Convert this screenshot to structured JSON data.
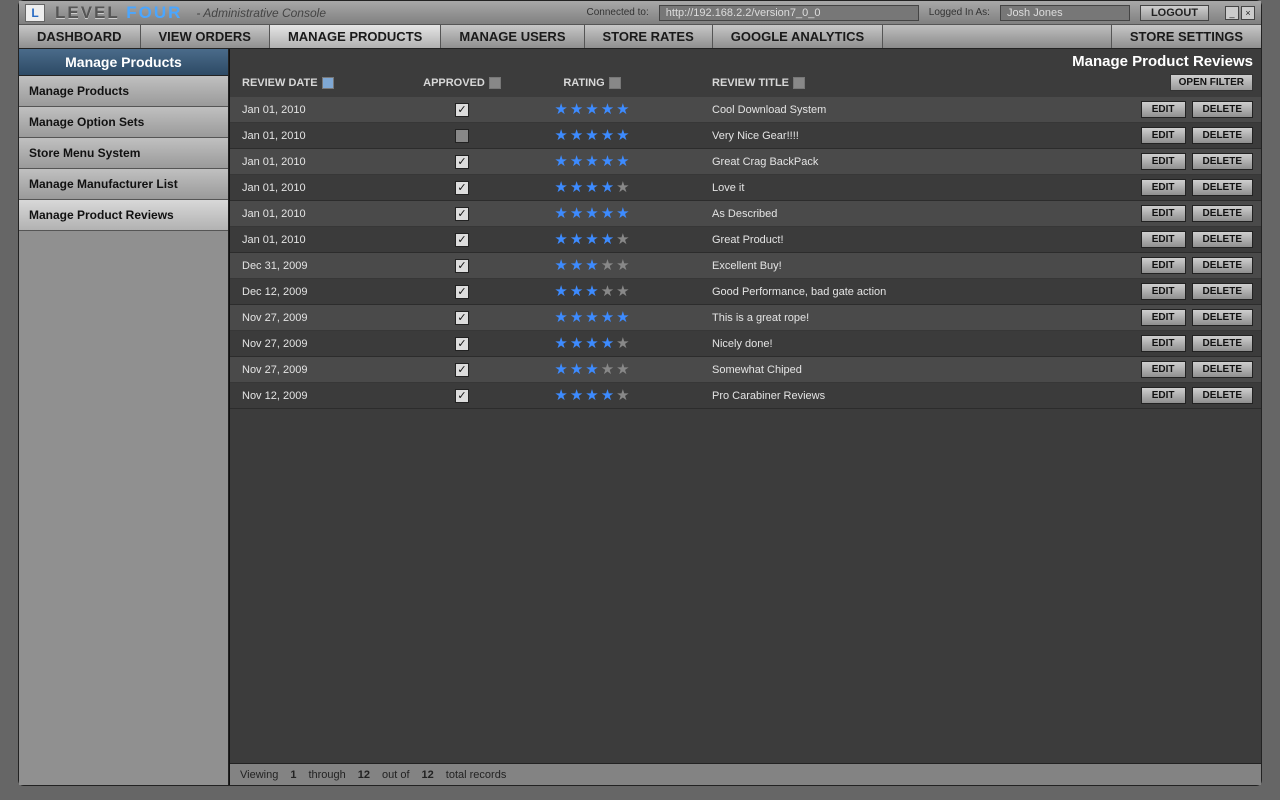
{
  "titlebar": {
    "logo_letter": "L",
    "brand_a": "LEVEL",
    "brand_b": "FOUR",
    "subtitle": "- Administrative Console",
    "connected_label": "Connected to:",
    "connected_url": "http://192.168.2.2/version7_0_0",
    "logged_in_label": "Logged In As:",
    "logged_in_user": "Josh Jones",
    "logout": "LOGOUT"
  },
  "tabs": {
    "dashboard": "DASHBOARD",
    "view_orders": "VIEW ORDERS",
    "manage_products": "MANAGE PRODUCTS",
    "manage_users": "MANAGE USERS",
    "store_rates": "STORE RATES",
    "google_analytics": "GOOGLE ANALYTICS",
    "store_settings": "STORE SETTINGS"
  },
  "sidebar": {
    "title": "Manage Products",
    "items": {
      "products": "Manage Products",
      "option_sets": "Manage Option Sets",
      "menu_system": "Store Menu System",
      "mfr_list": "Manage Manufacturer List",
      "reviews": "Manage Product Reviews"
    }
  },
  "page": {
    "title": "Manage Product Reviews",
    "open_filter": "OPEN FILTER",
    "columns": {
      "date": "REVIEW DATE",
      "approved": "APPROVED",
      "rating": "RATING",
      "title": "REVIEW TITLE"
    }
  },
  "buttons": {
    "edit": "EDIT",
    "delete": "DELETE"
  },
  "rows": [
    {
      "date": "Jan  01, 2010",
      "approved": true,
      "rating": 5,
      "title": "Cool Download System"
    },
    {
      "date": "Jan  01, 2010",
      "approved": false,
      "rating": 5,
      "title": "Very Nice Gear!!!!"
    },
    {
      "date": "Jan  01, 2010",
      "approved": true,
      "rating": 5,
      "title": "Great Crag BackPack"
    },
    {
      "date": "Jan  01, 2010",
      "approved": true,
      "rating": 4,
      "title": "Love it"
    },
    {
      "date": "Jan  01, 2010",
      "approved": true,
      "rating": 5,
      "title": "As Described"
    },
    {
      "date": "Jan  01, 2010",
      "approved": true,
      "rating": 4,
      "title": "Great Product!"
    },
    {
      "date": "Dec  31, 2009",
      "approved": true,
      "rating": 3,
      "title": "Excellent Buy!"
    },
    {
      "date": "Dec  12, 2009",
      "approved": true,
      "rating": 3,
      "title": "Good Performance, bad gate action"
    },
    {
      "date": "Nov  27, 2009",
      "approved": true,
      "rating": 5,
      "title": "This is a great rope!"
    },
    {
      "date": "Nov  27, 2009",
      "approved": true,
      "rating": 4,
      "title": "Nicely done!"
    },
    {
      "date": "Nov  27, 2009",
      "approved": true,
      "rating": 3,
      "title": "Somewhat Chiped"
    },
    {
      "date": "Nov  12, 2009",
      "approved": true,
      "rating": 4,
      "title": "Pro Carabiner Reviews"
    }
  ],
  "status": {
    "viewing": "Viewing",
    "from": "1",
    "through_label": "through",
    "to": "12",
    "outof_label": "out of",
    "total": "12",
    "suffix": "total records"
  }
}
